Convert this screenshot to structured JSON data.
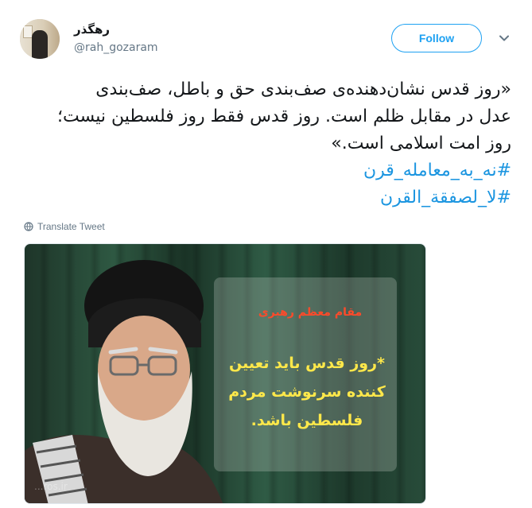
{
  "header": {
    "display_name": "رهگذر",
    "handle": "@rah_gozaram",
    "follow_label": "Follow",
    "avatar_icon": "user-avatar",
    "menu_icon": "chevron-down-icon"
  },
  "tweet": {
    "lines": [
      "«روز قدس نشان‌دهنده‌ی صف‌بندی حق و باطل، صف‌بندی",
      "عدل در مقابل ظلم است. روز قدس فقط روز فلسطین نیست؛",
      "روز امت اسلامی است.»"
    ],
    "hashtags": [
      "#نه_به_معامله_قرن",
      "#لا_لصفقة_القرن"
    ],
    "translate_label": "Translate Tweet"
  },
  "media": {
    "title": "مقام معظم رهبری",
    "body": "*روز قدس باید تعیین کننده سرنوشت مردم فلسطین باشد.",
    "watermark": "...ros.ir"
  },
  "colors": {
    "accent": "#1da1f2",
    "hashtag": "#1b95e0",
    "muted": "#657786"
  }
}
